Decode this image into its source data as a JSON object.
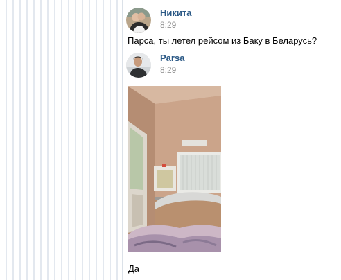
{
  "messages": [
    {
      "author": "Никита",
      "time": "8:29",
      "text": "Парса, ты летел рейсом из Баку в Беларусь?"
    },
    {
      "author": "Parsa",
      "time": "8:29",
      "attachment": "photo",
      "text": "Да"
    }
  ],
  "colors": {
    "author": "#2a5885",
    "time": "#939393",
    "stripe": "#e3e8ef"
  }
}
